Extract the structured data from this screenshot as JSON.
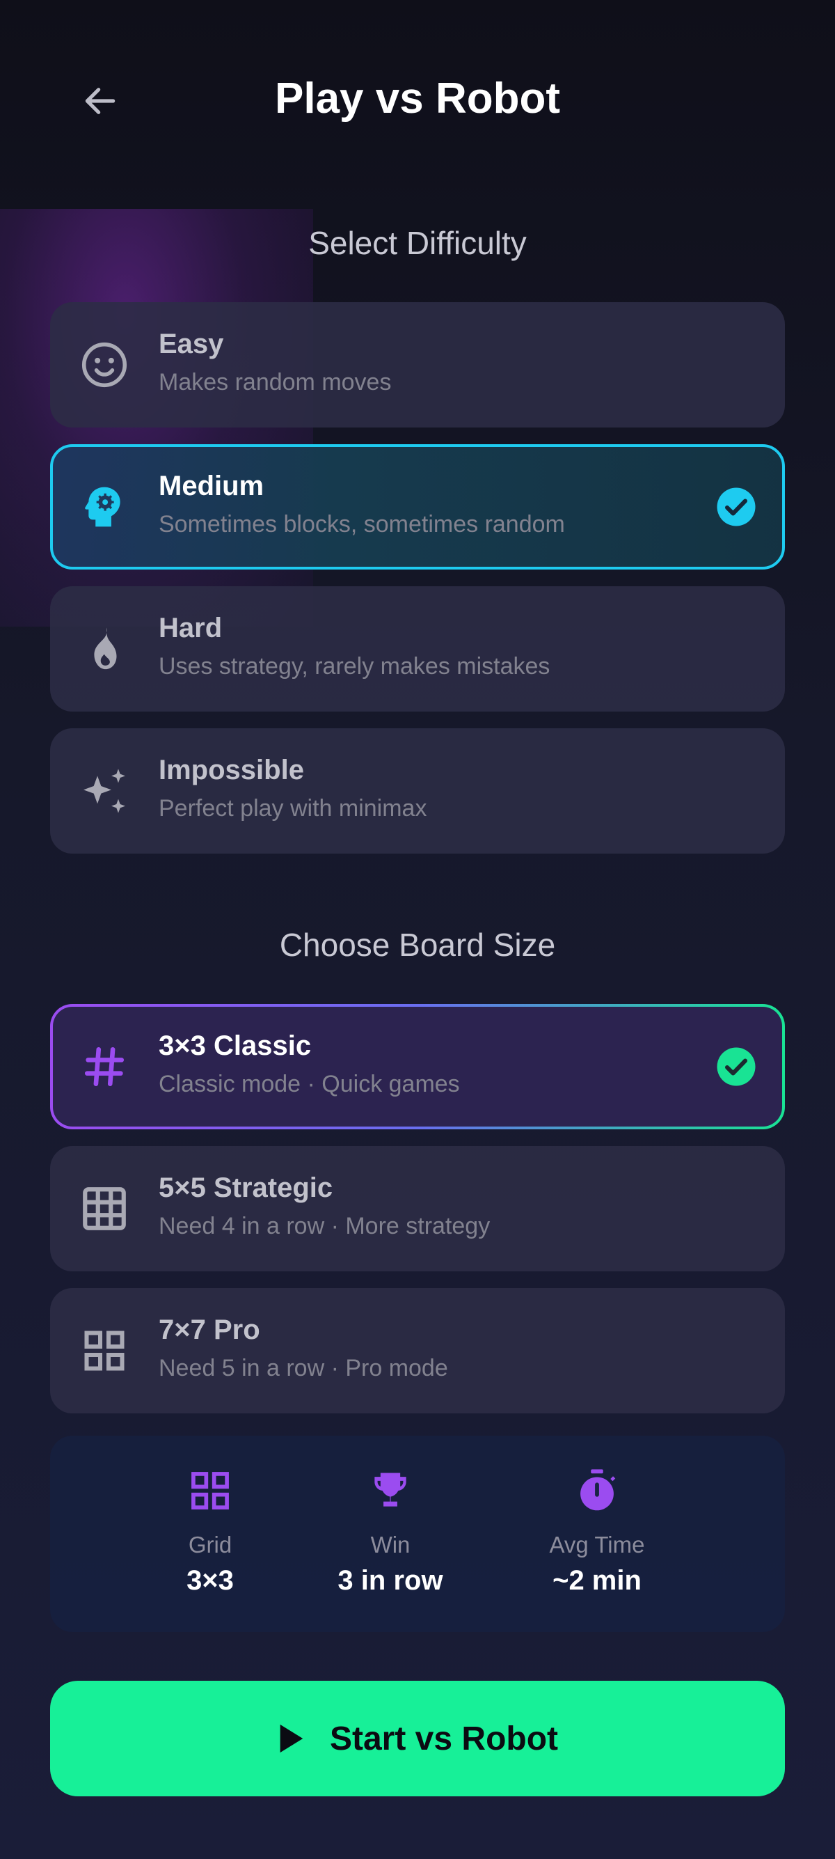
{
  "header": {
    "title": "Play vs Robot",
    "back_icon": "arrow-left-icon"
  },
  "difficulty": {
    "section_title": "Select Difficulty",
    "selected": "Medium",
    "items": [
      {
        "title": "Easy",
        "subtitle": "Makes random moves",
        "icon": "smiley-face-icon"
      },
      {
        "title": "Medium",
        "subtitle": "Sometimes blocks, sometimes random",
        "icon": "brain-gear-icon"
      },
      {
        "title": "Hard",
        "subtitle": "Uses strategy, rarely makes mistakes",
        "icon": "flame-icon"
      },
      {
        "title": "Impossible",
        "subtitle": "Perfect play with minimax",
        "icon": "sparkles-icon"
      }
    ]
  },
  "board": {
    "section_title": "Choose Board Size",
    "selected": "3×3 Classic",
    "items": [
      {
        "title": "3×3 Classic",
        "subtitle": "Classic mode · Quick games",
        "icon": "hash-icon"
      },
      {
        "title": "5×5 Strategic",
        "subtitle": "Need 4 in a row · More strategy",
        "icon": "grid-icon"
      },
      {
        "title": "7×7 Pro",
        "subtitle": "Need 5 in a row · Pro mode",
        "icon": "four-squares-icon"
      }
    ]
  },
  "stats": {
    "grid": {
      "label": "Grid",
      "value": "3×3",
      "icon": "grid-squares-icon"
    },
    "win": {
      "label": "Win",
      "value": "3 in row",
      "icon": "trophy-icon"
    },
    "avg_time": {
      "label": "Avg Time",
      "value": "~2 min",
      "icon": "stopwatch-icon"
    }
  },
  "start_button": {
    "label": "Start vs Robot",
    "icon": "play-icon"
  },
  "colors": {
    "background": "#12131f",
    "card": "#2c2c46",
    "accent_cyan": "#1ecbf0",
    "accent_purple": "#9b4cf0",
    "accent_green": "#17f098"
  }
}
